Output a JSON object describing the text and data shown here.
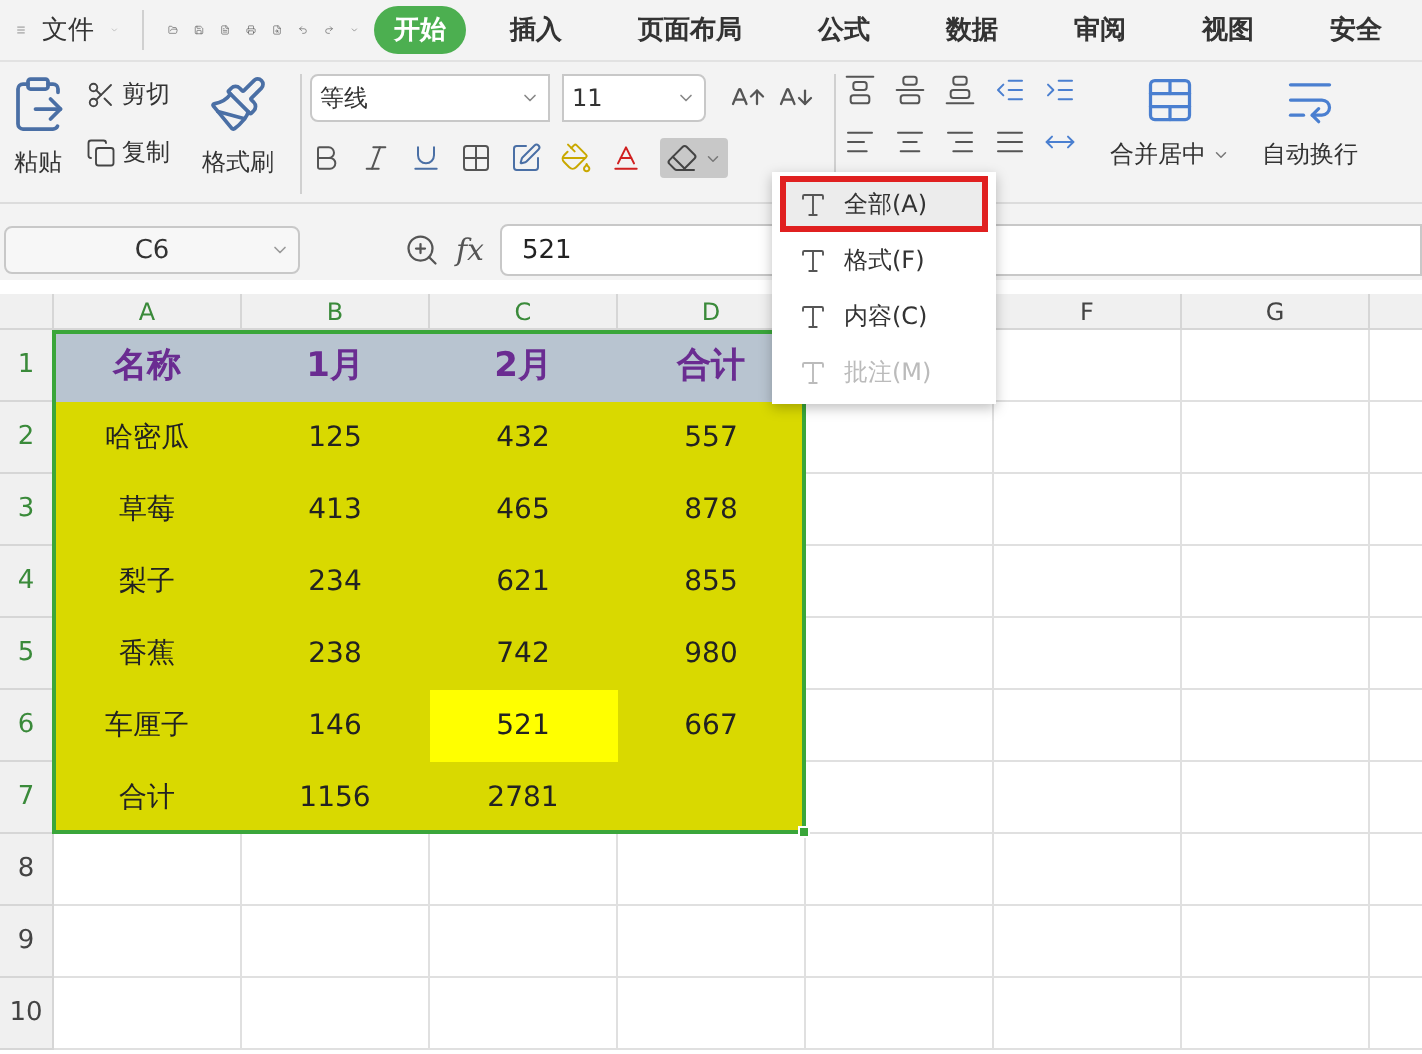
{
  "menu": {
    "label": "文件"
  },
  "tabs": [
    {
      "label": "开始",
      "selected": true
    },
    {
      "label": "插入",
      "selected": false
    },
    {
      "label": "页面布局",
      "selected": false
    },
    {
      "label": "公式",
      "selected": false
    },
    {
      "label": "数据",
      "selected": false
    },
    {
      "label": "审阅",
      "selected": false
    },
    {
      "label": "视图",
      "selected": false
    },
    {
      "label": "安全",
      "selected": false
    }
  ],
  "ribbon": {
    "paste": "粘贴",
    "cut": "剪切",
    "copy": "复制",
    "format_painter": "格式刷",
    "font_name": "等线",
    "font_size": "11",
    "merge": "合并居中",
    "wrap": "自动换行"
  },
  "name_box": "C6",
  "formula_label": "fx",
  "formula": "521",
  "columns": [
    {
      "label": "A",
      "selected": true
    },
    {
      "label": "B",
      "selected": true
    },
    {
      "label": "C",
      "selected": true
    },
    {
      "label": "D",
      "selected": true
    },
    {},
    {
      "label": "F",
      "selected": false
    },
    {
      "label": "G",
      "selected": false
    }
  ],
  "rows": [
    {
      "header": "1",
      "kind": "title",
      "cells": [
        {
          "text": "名称"
        },
        {
          "text": "1月"
        },
        {
          "text": "2月"
        },
        {
          "text": "合计"
        }
      ]
    },
    {
      "header": "2",
      "kind": "data",
      "cells": [
        {
          "text": "哈密瓜",
          "selected": false
        },
        {
          "text": "125",
          "selected": false
        },
        {
          "text": "432",
          "selected": false
        },
        {
          "text": "557",
          "selected": false
        }
      ]
    },
    {
      "header": "3",
      "kind": "data",
      "cells": [
        {
          "text": "草莓",
          "selected": false
        },
        {
          "text": "413",
          "selected": false
        },
        {
          "text": "465",
          "selected": false
        },
        {
          "text": "878",
          "selected": false
        }
      ]
    },
    {
      "header": "4",
      "kind": "data",
      "cells": [
        {
          "text": "梨子",
          "selected": false
        },
        {
          "text": "234",
          "selected": false
        },
        {
          "text": "621",
          "selected": false
        },
        {
          "text": "855",
          "selected": false
        }
      ]
    },
    {
      "header": "5",
      "kind": "data",
      "cells": [
        {
          "text": "香蕉",
          "selected": false
        },
        {
          "text": "238",
          "selected": false
        },
        {
          "text": "742",
          "selected": false
        },
        {
          "text": "980",
          "selected": false
        }
      ]
    },
    {
      "header": "6",
      "kind": "data",
      "cells": [
        {
          "text": "车厘子",
          "selected": false
        },
        {
          "text": "146",
          "selected": false
        },
        {
          "text": "521",
          "selected": true
        },
        {
          "text": "667",
          "selected": false
        }
      ]
    },
    {
      "header": "7",
      "kind": "data",
      "cells": [
        {
          "text": "合计",
          "selected": false
        },
        {
          "text": "1156",
          "selected": false
        },
        {
          "text": "2781",
          "selected": false
        },
        {
          "selected": false
        }
      ]
    },
    {
      "header": "8",
      "kind": "empty"
    },
    {
      "header": "9",
      "kind": "empty"
    },
    {
      "header": "10",
      "kind": "empty"
    }
  ],
  "clear_menu": [
    {
      "label": "全部(A)",
      "highlighted": true,
      "disabled": false
    },
    {
      "label": "格式(F)",
      "highlighted": false,
      "disabled": false
    },
    {
      "label": "内容(C)",
      "highlighted": false,
      "disabled": false
    },
    {
      "label": "批注(M)",
      "highlighted": false,
      "disabled": true
    }
  ]
}
